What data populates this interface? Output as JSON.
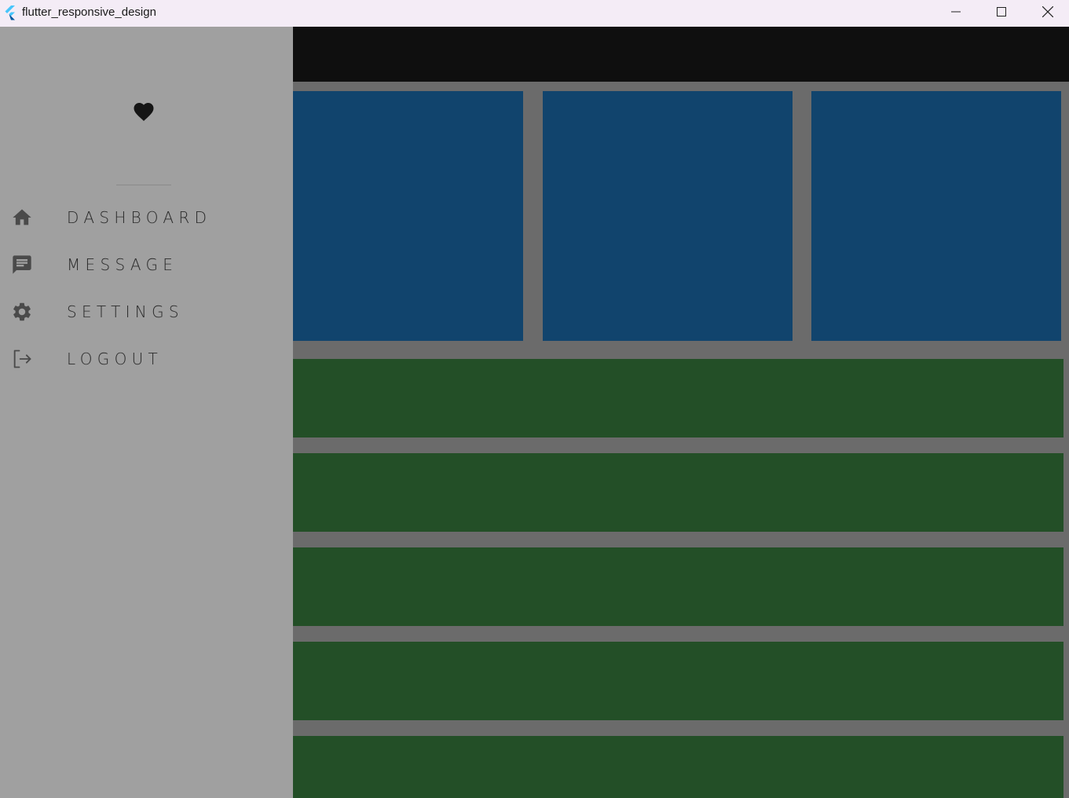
{
  "window": {
    "title": "flutter_responsive_design",
    "controls": [
      "minimize-icon",
      "maximize-icon",
      "close-icon"
    ]
  },
  "drawer": {
    "logo_icon": "heart-icon",
    "items": [
      {
        "label": "DASHBOARD",
        "icon": "home-icon"
      },
      {
        "label": "MESSAGE",
        "icon": "message-icon"
      },
      {
        "label": "SETTINGS",
        "icon": "gear-icon"
      },
      {
        "label": "LOGOUT",
        "icon": "logout-icon"
      }
    ]
  },
  "colors": {
    "drawer_background": "#a0a0a0",
    "scrim_background": "#6b6b6b",
    "appbar": "#0f0f0f",
    "card_blue": "#11446d",
    "row_green": "#234f27"
  },
  "main": {
    "cards": 3,
    "rows": 5
  }
}
